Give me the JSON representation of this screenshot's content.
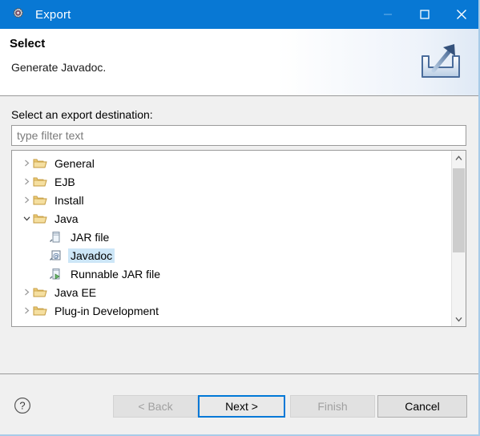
{
  "window": {
    "title": "Export",
    "title_icon": "gear-icon",
    "accent_color": "#0878d4",
    "controls": [
      {
        "name": "minimize",
        "glyph": "minimize-icon"
      },
      {
        "name": "maximize",
        "glyph": "maximize-icon"
      },
      {
        "name": "close",
        "glyph": "close-icon"
      }
    ]
  },
  "header": {
    "title": "Select",
    "subtitle": "Generate Javadoc.",
    "icon": "export-arrow-icon"
  },
  "main": {
    "destination_label": "Select an export destination:",
    "filter": {
      "value": "",
      "placeholder": "type filter text"
    },
    "tree": [
      {
        "label": "General",
        "icon": "folder-icon",
        "expanded": false,
        "level": 0,
        "selected": false
      },
      {
        "label": "EJB",
        "icon": "folder-icon",
        "expanded": false,
        "level": 0,
        "selected": false
      },
      {
        "label": "Install",
        "icon": "folder-icon",
        "expanded": false,
        "level": 0,
        "selected": false
      },
      {
        "label": "Java",
        "icon": "folder-icon",
        "expanded": true,
        "level": 0,
        "selected": false
      },
      {
        "label": "JAR file",
        "icon": "jar-file-icon",
        "level": 1,
        "selected": false
      },
      {
        "label": "Javadoc",
        "icon": "javadoc-icon",
        "level": 1,
        "selected": true
      },
      {
        "label": "Runnable JAR file",
        "icon": "runnable-jar-icon",
        "level": 1,
        "selected": false
      },
      {
        "label": "Java EE",
        "icon": "folder-icon",
        "expanded": false,
        "level": 0,
        "selected": false
      },
      {
        "label": "Plug-in Development",
        "icon": "folder-icon",
        "expanded": false,
        "level": 0,
        "selected": false
      }
    ]
  },
  "footer": {
    "help_icon": "help-question-icon",
    "buttons": {
      "back": {
        "label": "< Back",
        "state": "disabled"
      },
      "next": {
        "label": "Next >",
        "state": "focused"
      },
      "finish": {
        "label": "Finish",
        "state": "disabled"
      },
      "cancel": {
        "label": "Cancel",
        "state": "normal"
      }
    }
  }
}
